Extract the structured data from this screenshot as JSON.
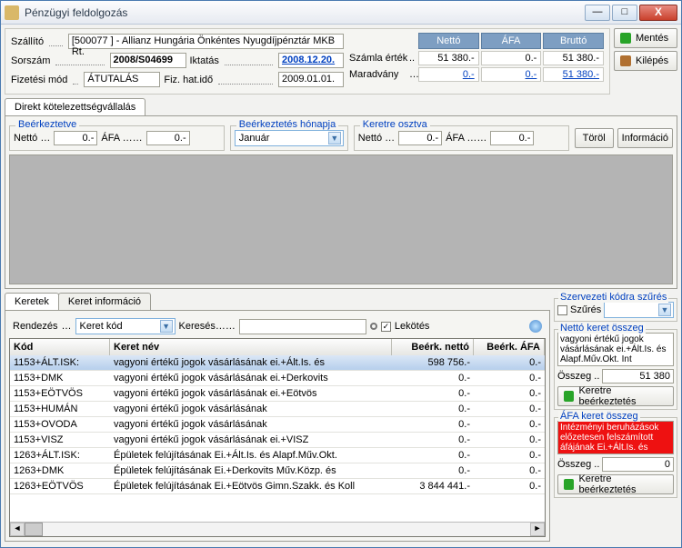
{
  "window": {
    "title": "Pénzügyi feldolgozás"
  },
  "buttons": {
    "save": "Mentés",
    "exit": "Kilépés",
    "delete": "Töröl",
    "info": "Információ",
    "apply": "Keretre beérkeztetés"
  },
  "form": {
    "supplier_lbl": "Szállító",
    "supplier": "[500077 ] - Allianz Hungária Önkéntes Nyugdíjpénztár MKB Rt.",
    "seq_lbl": "Sorszám",
    "seq": "2008/S04699",
    "reg_lbl": "Iktatás",
    "reg": "2008.12.20.",
    "pay_lbl": "Fizetési mód",
    "pay": "ÁTUTALÁS",
    "due_lbl": "Fiz. hat.idő",
    "due": "2009.01.01.",
    "invoice_lbl": "Számla érték",
    "remain_lbl": "Maradvány"
  },
  "totals": {
    "hdr": {
      "net": "Nettó",
      "vat": "ÁFA",
      "gross": "Bruttó"
    },
    "invoice": {
      "net": "51 380.-",
      "vat": "0.-",
      "gross": "51 380.-"
    },
    "remain": {
      "net": "0.-",
      "vat": "0.-",
      "gross": "51 380.-"
    }
  },
  "tabs": {
    "direct": "Direkt kötelezettségvállalás",
    "keretek": "Keretek",
    "keretinfo": "Keret információ"
  },
  "groups": {
    "received": {
      "legend": "Beérkeztetve",
      "net_lbl": "Nettó …",
      "net": "0.-",
      "vat_lbl": "ÁFA ……",
      "vat": "0.-"
    },
    "month": {
      "legend": "Beérkeztetés hónapja",
      "value": "Január"
    },
    "split": {
      "legend": "Keretre osztva",
      "net_lbl": "Nettó …",
      "net": "0.-",
      "vat_lbl": "ÁFA ……",
      "vat": "0.-"
    }
  },
  "filter": {
    "sort_lbl": "Rendezés",
    "sort_value": "Keret kód",
    "search_lbl": "Keresés……",
    "bind_lbl": "Lekötés"
  },
  "table": {
    "cols": {
      "code": "Kód",
      "name": "Keret név",
      "net": "Beérk. nettó",
      "vat": "Beérk. ÁFA"
    },
    "rows": [
      {
        "code": "1153+ÁLT.ISK:",
        "name": "vagyoni értékű jogok vásárlásának ei.+Ált.Is. és",
        "net": "598 756.-",
        "vat": "0.-",
        "sel": true
      },
      {
        "code": "1153+DMK",
        "name": "vagyoni értékű jogok vásárlásának ei.+Derkovits",
        "net": "0.-",
        "vat": "0.-"
      },
      {
        "code": "1153+EÖTVÖS",
        "name": "vagyoni értékű jogok vásárlásának ei.+Eötvös",
        "net": "0.-",
        "vat": "0.-"
      },
      {
        "code": "1153+HUMÁN",
        "name": "vagyoni értékű jogok vásárlásának",
        "net": "0.-",
        "vat": "0.-"
      },
      {
        "code": "1153+OVODA",
        "name": "vagyoni értékű jogok vásárlásának",
        "net": "0.-",
        "vat": "0.-"
      },
      {
        "code": "1153+VISZ",
        "name": "vagyoni értékű jogok vásárlásának ei.+VISZ",
        "net": "0.-",
        "vat": "0.-"
      },
      {
        "code": "1263+ÁLT.ISK:",
        "name": "Épületek felújításának Ei.+Ált.Is. és Alapf.Műv.Okt.",
        "net": "0.-",
        "vat": "0.-"
      },
      {
        "code": "1263+DMK",
        "name": "Épületek felújításának Ei.+Derkovits Műv.Közp. és",
        "net": "0.-",
        "vat": "0.-"
      },
      {
        "code": "1263+EÖTVÖS",
        "name": "Épületek felújításának Ei.+Eötvös Gimn.Szakk. és Koll",
        "net": "3 844 441.-",
        "vat": "0.-"
      }
    ]
  },
  "side": {
    "orgfilter": {
      "legend": "Szervezeti kódra szűrés",
      "chk_lbl": "Szűrés"
    },
    "netbox": {
      "legend": "Nettó keret összeg",
      "desc": "vagyoni értékű jogok vásárlásának ei.+Ált.Is. és Alapf.Műv.Okt. Int",
      "sum_lbl": "Összeg",
      "sum": "51 380"
    },
    "vatbox": {
      "legend": "ÁFA keret összeg",
      "desc": "Intézményi beruházások előzetesen felszámított áfájának Ei.+Ált.Is. és",
      "sum_lbl": "Összeg",
      "sum": "0"
    }
  }
}
